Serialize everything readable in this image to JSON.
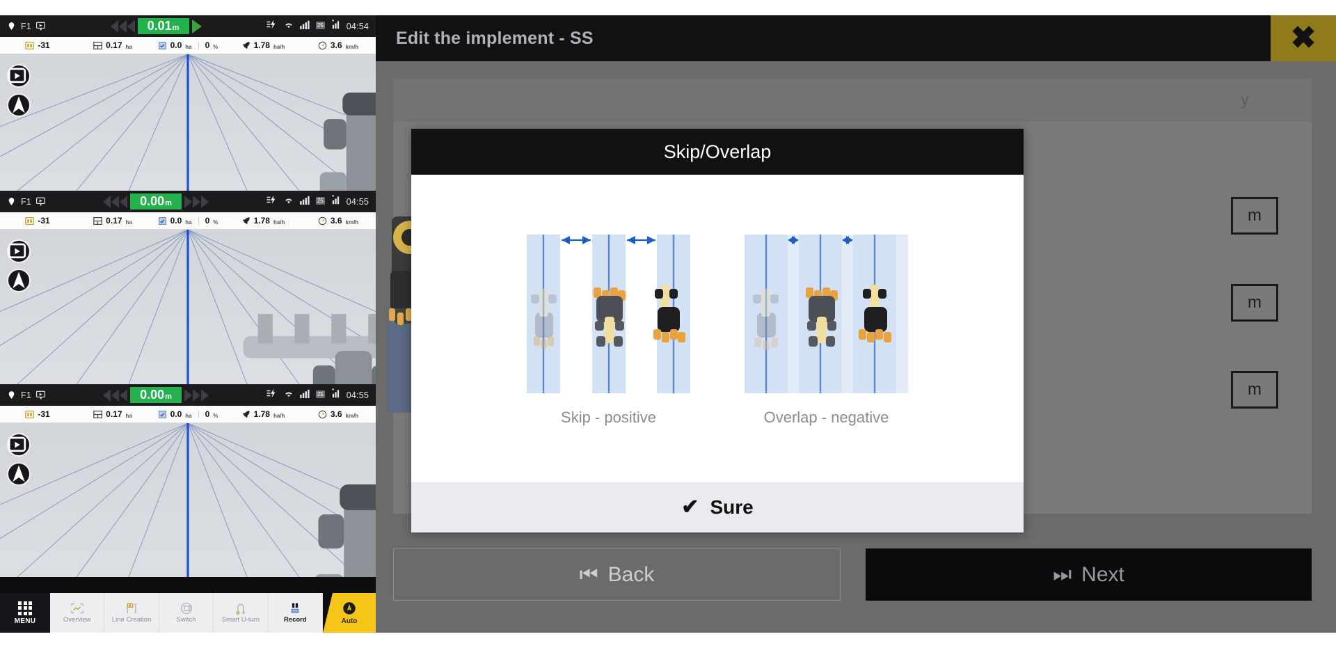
{
  "guidance": {
    "panels": [
      {
        "status": {
          "position_icon": "pin-icon",
          "line_label": "F1",
          "flag_icon": "flag-icon",
          "deviation": "0.01",
          "deviation_unit": "m",
          "left_arrows": 3,
          "right_arrows": 0,
          "go_arrow": true,
          "charging_icon": "charging-icon",
          "wifi_icon": "wifi-icon",
          "signal_icon": "signal-icon",
          "signal_badge": "25",
          "signal2_icon": "gps-signal-icon",
          "time": "04:54"
        },
        "stats": [
          {
            "icon": "elevation-icon",
            "value": "-31",
            "unit": ""
          },
          {
            "icon": "field-area-icon",
            "value": "0.17",
            "unit": "ha"
          },
          {
            "icon": "worked-area-icon",
            "value": "0.0",
            "unit": "ha",
            "value2": "0",
            "unit2": "%"
          },
          {
            "icon": "rate-icon",
            "value": "1.78",
            "unit": "ha/h"
          },
          {
            "icon": "speed-icon",
            "value": "3.6",
            "unit": "km/h"
          }
        ],
        "vehicle": "tractor-top-view"
      },
      {
        "status": {
          "position_icon": "pin-icon",
          "line_label": "F1",
          "flag_icon": "flag-icon",
          "deviation": "0.00",
          "deviation_unit": "m",
          "left_arrows": 3,
          "right_arrows": 3,
          "go_arrow": false,
          "charging_icon": "charging-icon",
          "wifi_icon": "wifi-icon",
          "signal_icon": "signal-icon",
          "signal_badge": "25",
          "signal2_icon": "gps-signal-icon",
          "time": "04:55"
        },
        "stats": [
          {
            "icon": "elevation-icon",
            "value": "-31",
            "unit": ""
          },
          {
            "icon": "field-area-icon",
            "value": "0.17",
            "unit": "ha"
          },
          {
            "icon": "worked-area-icon",
            "value": "0.0",
            "unit": "ha",
            "value2": "0",
            "unit2": "%"
          },
          {
            "icon": "rate-icon",
            "value": "1.78",
            "unit": "ha/h"
          },
          {
            "icon": "speed-icon",
            "value": "3.6",
            "unit": "km/h"
          }
        ],
        "vehicle": "tractor-with-implement-top-view"
      },
      {
        "status": {
          "position_icon": "pin-icon",
          "line_label": "F1",
          "flag_icon": "flag-icon",
          "deviation": "0.00",
          "deviation_unit": "m",
          "left_arrows": 3,
          "right_arrows": 3,
          "go_arrow": false,
          "charging_icon": "charging-icon",
          "wifi_icon": "wifi-icon",
          "signal_icon": "signal-icon",
          "signal_badge": "25",
          "signal2_icon": "gps-signal-icon",
          "time": "04:55"
        },
        "stats": [
          {
            "icon": "elevation-icon",
            "value": "-31",
            "unit": ""
          },
          {
            "icon": "field-area-icon",
            "value": "0.17",
            "unit": "ha"
          },
          {
            "icon": "worked-area-icon",
            "value": "0.0",
            "unit": "ha",
            "value2": "0",
            "unit2": "%"
          },
          {
            "icon": "rate-icon",
            "value": "1.78",
            "unit": "ha/h"
          },
          {
            "icon": "speed-icon",
            "value": "3.6",
            "unit": "km/h"
          }
        ],
        "vehicle": "tractor-top-view"
      }
    ],
    "bottom_nav": {
      "menu_label": "MENU",
      "items": [
        {
          "label": "Overview",
          "icon": "overview-icon",
          "active": false
        },
        {
          "label": "Line Creation",
          "icon": "line-creation-icon",
          "active": false
        },
        {
          "label": "Switch",
          "icon": "switch-icon",
          "active": false
        },
        {
          "label": "Smart U-turn",
          "icon": "smart-uturn-icon",
          "active": false
        },
        {
          "label": "Record",
          "icon": "record-icon",
          "active": true
        }
      ],
      "auto_label": "Auto",
      "auto_icon": "auto-steer-icon",
      "auto_color": "#f5c518"
    }
  },
  "edit_screen": {
    "title": "Edit the implement - SS",
    "close_icon": "close-icon",
    "close_bg": "#8f7a1c",
    "background_tab_text": "y",
    "unit_boxes": [
      "m",
      "m",
      "m"
    ],
    "back_button": {
      "label": "Back",
      "icon": "skip-back-icon"
    },
    "next_button": {
      "label": "Next",
      "icon": "skip-next-icon"
    }
  },
  "modal": {
    "title": "Skip/Overlap",
    "diagrams": [
      {
        "caption": "Skip - positive",
        "type": "skip",
        "passes": 3,
        "arrow_direction": "outward",
        "band_color": "#d3e1f5",
        "line_color": "#5b88d6"
      },
      {
        "caption": "Overlap - negative",
        "type": "overlap",
        "passes": 3,
        "arrow_direction": "inward",
        "band_color": "#d3e1f5",
        "line_color": "#5b88d6"
      }
    ],
    "confirm_button": {
      "label": "Sure",
      "icon": "check-icon"
    }
  }
}
